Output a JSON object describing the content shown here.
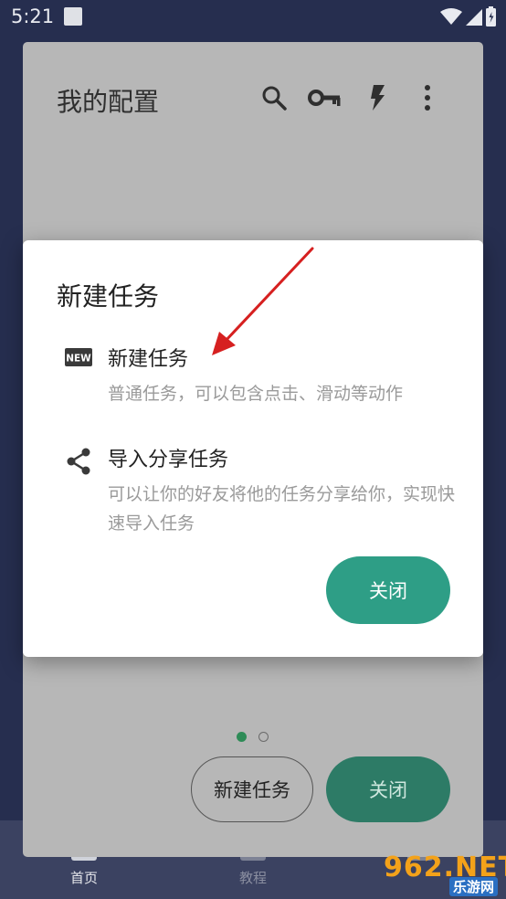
{
  "status_bar": {
    "time": "5:21"
  },
  "background": {
    "title": "我的配置",
    "toolbar_icons": [
      "search-icon",
      "key-icon",
      "flash-icon",
      "more-vert-icon"
    ],
    "new_task_button": "新建任务",
    "close_button": "关闭",
    "page_indicator": {
      "count": 2,
      "active": 1
    }
  },
  "bottom_nav": {
    "items": [
      {
        "label": "首页",
        "icon": "home-icon",
        "active": true
      },
      {
        "label": "教程",
        "icon": "tutorial-icon",
        "active": false
      },
      {
        "label": "",
        "icon": "nav-icon",
        "active": false
      }
    ]
  },
  "dialog": {
    "title": "新建任务",
    "options": [
      {
        "icon": "new-badge-icon",
        "title": "新建任务",
        "description": "普通任务，可以包含点击、滑动等动作"
      },
      {
        "icon": "share-icon",
        "title": "导入分享任务",
        "description": "可以让你的好友将他的任务分享给你，实现快速导入任务"
      }
    ],
    "close_button": "关闭"
  },
  "watermark": {
    "main": "962.NET",
    "sub": "乐游网"
  },
  "colors": {
    "app_background": "#262e4f",
    "dim_card": "#b7b7b7",
    "accent": "#2e9e86",
    "accent_dimmed": "#2d7b66",
    "annotation_arrow": "#d62020"
  }
}
